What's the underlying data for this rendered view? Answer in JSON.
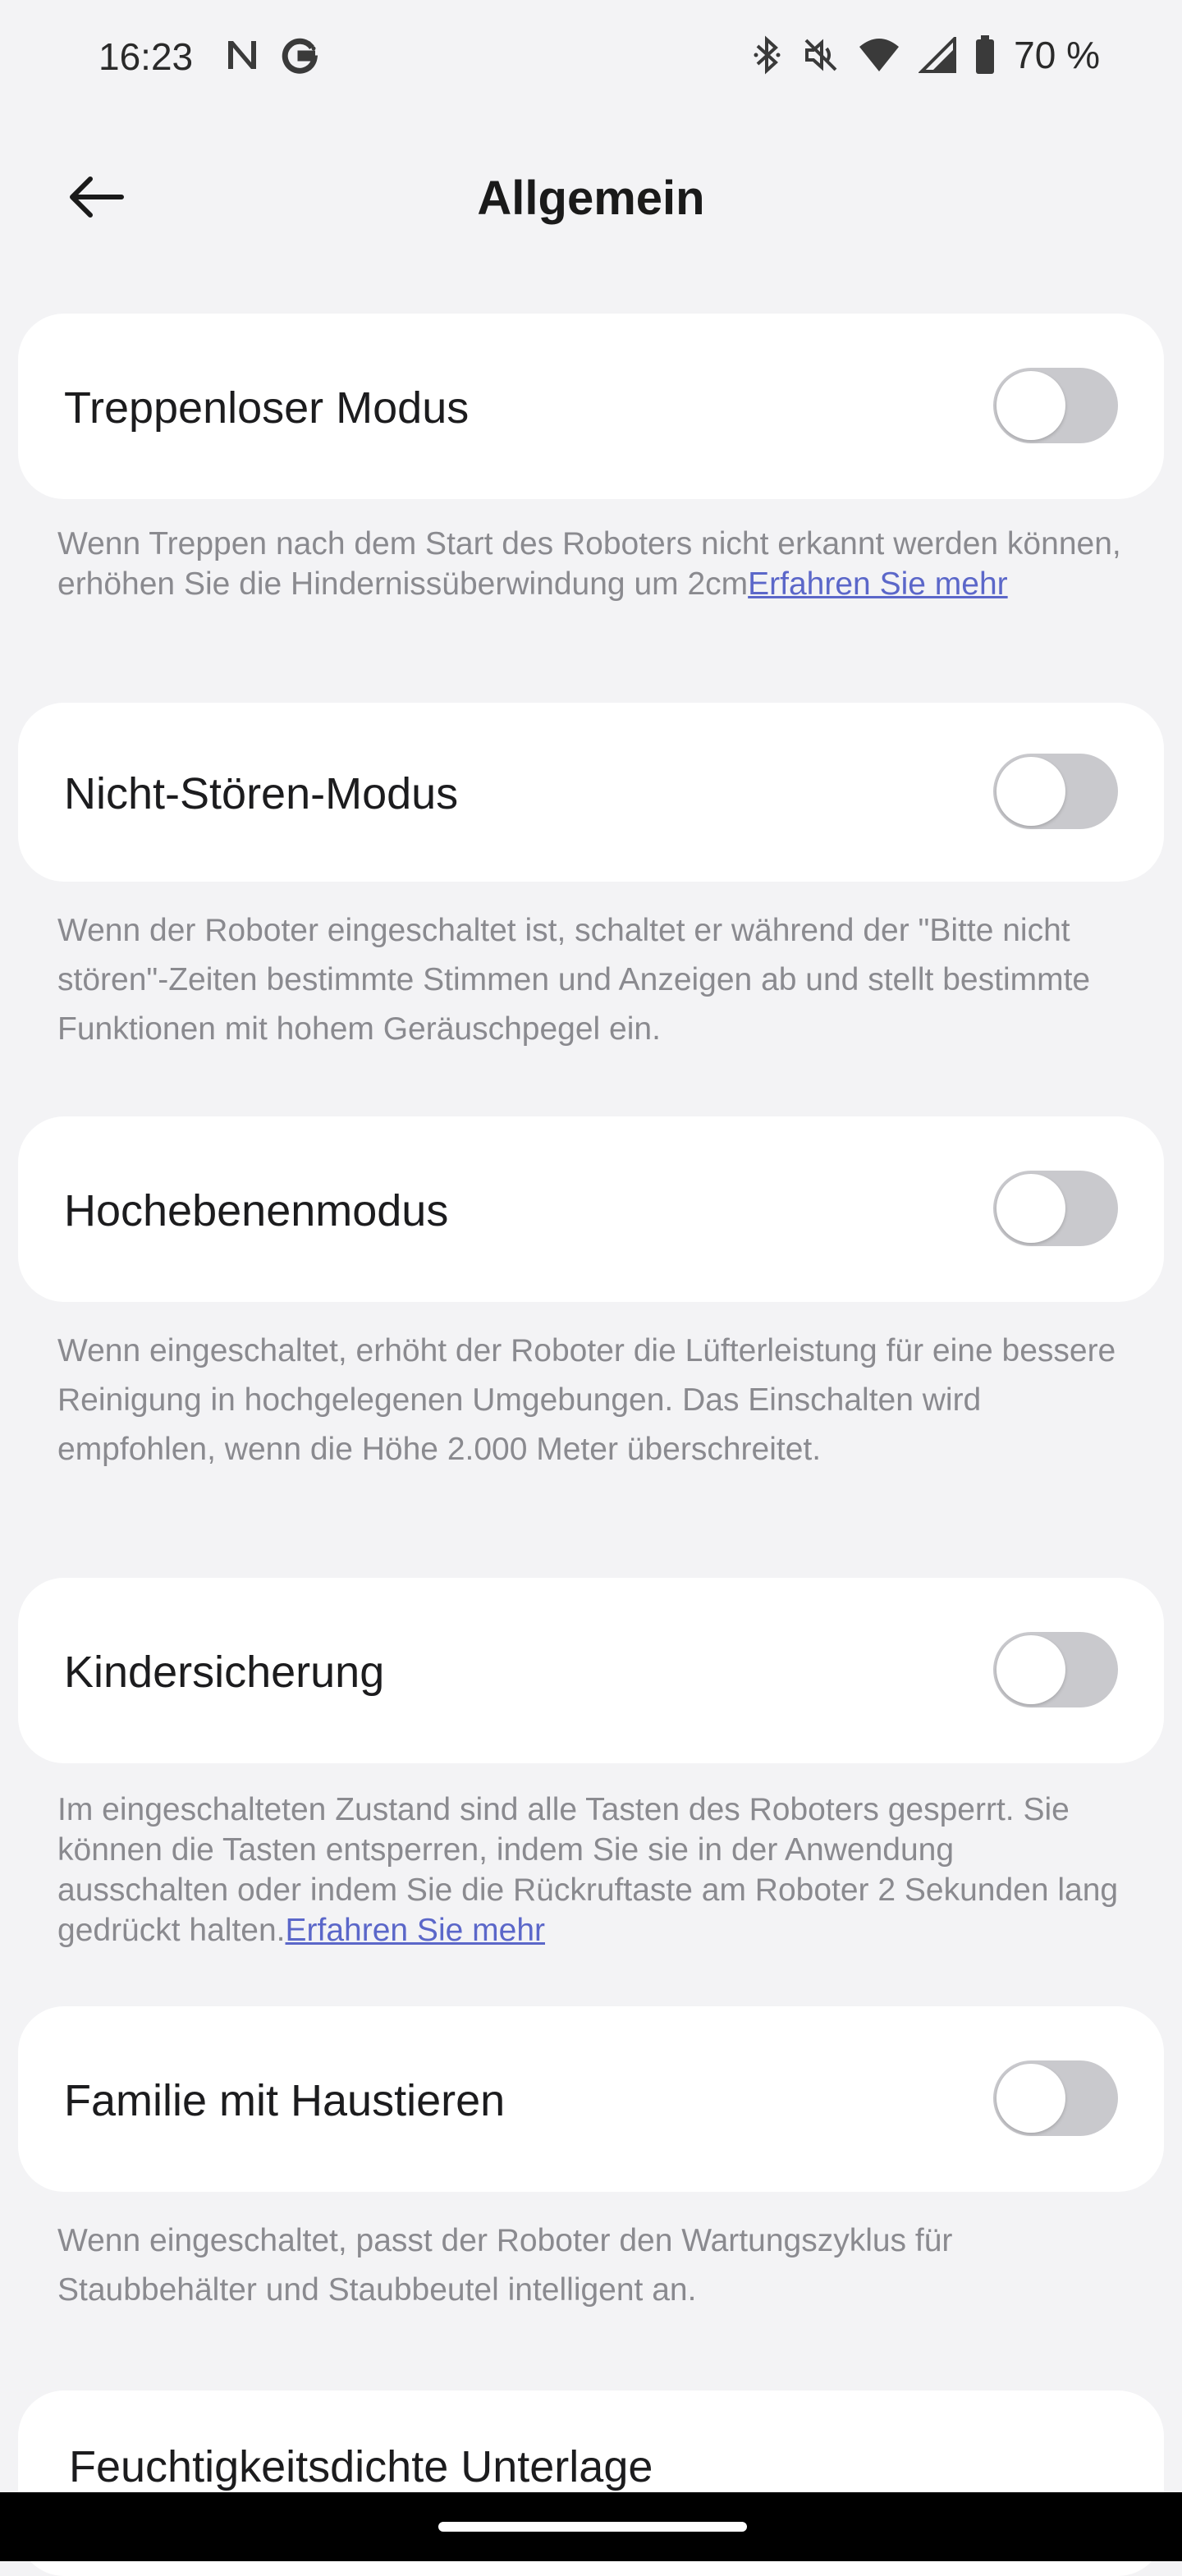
{
  "status_bar": {
    "time": "16:23",
    "battery": "70 %",
    "icons": [
      "n-icon",
      "g-icon",
      "bluetooth-icon",
      "mute-icon",
      "wifi-icon",
      "signal-icon",
      "battery-icon"
    ]
  },
  "header": {
    "title": "Allgemein",
    "back_icon": "arrow-left-icon"
  },
  "settings": [
    {
      "label": "Treppenloser Modus",
      "enabled": false,
      "description": "Wenn Treppen nach dem Start des Roboters nicht erkannt werden können, erhöhen Sie die Hindernissüberwindung um 2cm",
      "link": "Erfahren Sie mehr"
    },
    {
      "label": "Nicht-Stören-Modus",
      "enabled": false,
      "description": "Wenn der Roboter eingeschaltet ist, schaltet er während der \"Bitte nicht stören\"-Zeiten bestimmte Stimmen und Anzeigen ab und stellt bestimmte Funktionen mit hohem Geräuschpegel ein."
    },
    {
      "label": "Hochebenenmodus",
      "enabled": false,
      "description": "Wenn eingeschaltet, erhöht der Roboter die Lüfterleistung für eine bessere Reinigung in hochgelegenen Umgebungen. Das Einschalten wird empfohlen, wenn die Höhe 2.000 Meter überschreitet."
    },
    {
      "label": "Kindersicherung",
      "enabled": false,
      "description": "Im eingeschalteten Zustand sind alle Tasten des Roboters gesperrt. Sie können die Tasten entsperren, indem Sie sie in der Anwendung ausschalten oder indem Sie die Rückruftaste am Roboter 2 Sekunden lang gedrückt halten.",
      "link": "Erfahren Sie mehr"
    },
    {
      "label": "Familie mit Haustieren",
      "enabled": false,
      "description": "Wenn eingeschaltet, passt der Roboter den Wartungszyklus für Staubbehälter und Staubbeutel intelligent an."
    },
    {
      "label": "Feuchtigkeitsdichte Unterlage"
    }
  ],
  "colors": {
    "background": "#f3f3f5",
    "card": "#ffffff",
    "toggle_off": "#c9c9cd",
    "link": "#5b67c9",
    "description": "#8a8a8f"
  }
}
